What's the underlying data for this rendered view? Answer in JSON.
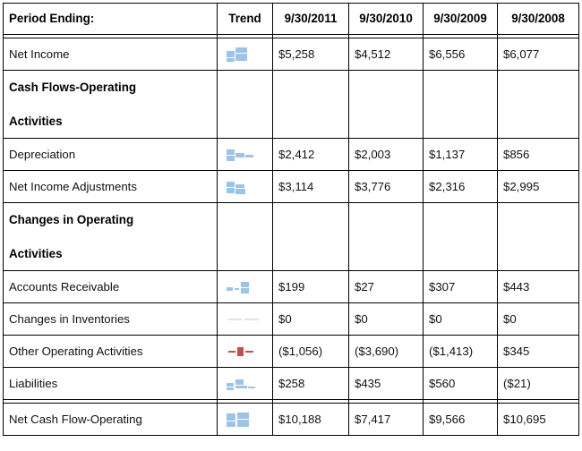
{
  "table": {
    "columns": [
      {
        "key": "label",
        "header": "Period Ending:",
        "align": "left"
      },
      {
        "key": "trend",
        "header": "Trend",
        "align": "center"
      },
      {
        "key": "y2011",
        "header": "9/30/2011",
        "align": "center"
      },
      {
        "key": "y2010",
        "header": "9/30/2010",
        "align": "center"
      },
      {
        "key": "y2009",
        "header": "9/30/2009",
        "align": "center"
      },
      {
        "key": "y2008",
        "header": "9/30/2008",
        "align": "center"
      }
    ],
    "rows": [
      {
        "type": "data",
        "label": "Net Income",
        "trend_icon": "sparkline-bars-blue",
        "trend_color": "#9dc3e6",
        "values": [
          "$5,258",
          "$4,512",
          "$6,556",
          "$6,077"
        ],
        "separator_before": true
      },
      {
        "type": "group",
        "label_line1": "Cash Flows-Operating",
        "label_line2": "Activities",
        "values": [
          "",
          "",
          "",
          ""
        ]
      },
      {
        "type": "data",
        "label": "Depreciation",
        "trend_icon": "sparkline-bars-blue",
        "trend_color": "#9dc3e6",
        "values": [
          "$2,412",
          "$2,003",
          "$1,137",
          "$856"
        ]
      },
      {
        "type": "data",
        "label": "Net Income Adjustments",
        "trend_icon": "sparkline-bars-blue",
        "trend_color": "#9dc3e6",
        "values": [
          "$3,114",
          "$3,776",
          "$2,316",
          "$2,995"
        ]
      },
      {
        "type": "group",
        "label_line1": "Changes in Operating",
        "label_line2": "Activities",
        "values": [
          "",
          "",
          "",
          ""
        ]
      },
      {
        "type": "data",
        "label": "Accounts Receivable",
        "trend_icon": "sparkline-bars-blue",
        "trend_color": "#9dc3e6",
        "values": [
          "$199",
          "$27",
          "$307",
          "$443"
        ]
      },
      {
        "type": "data",
        "label": "Changes in Inventories",
        "trend_icon": "sparkline-flat-line",
        "trend_color": "#d9d9d9",
        "values": [
          "$0",
          "$0",
          "$0",
          "$0"
        ]
      },
      {
        "type": "data",
        "label": "Other Operating Activities",
        "trend_icon": "sparkline-bars-red",
        "trend_color": "#c0504d",
        "values": [
          "($1,056)",
          "($3,690)",
          "($1,413)",
          "$345"
        ]
      },
      {
        "type": "data",
        "label": "Liabilities",
        "trend_icon": "sparkline-bars-blue",
        "trend_color": "#9dc3e6",
        "values": [
          "$258",
          "$435",
          "$560",
          "($21)"
        ]
      },
      {
        "type": "data",
        "label": "Net Cash Flow-Operating",
        "trend_icon": "sparkline-bars-blue",
        "trend_color": "#9dc3e6",
        "values": [
          "$10,188",
          "$7,417",
          "$9,566",
          "$10,695"
        ],
        "separator_before": true
      }
    ]
  },
  "chart_data": {
    "type": "table",
    "title": "Period Ending:",
    "categories": [
      "9/30/2011",
      "9/30/2010",
      "9/30/2009",
      "9/30/2008"
    ],
    "series": [
      {
        "name": "Net Income",
        "values": [
          5258,
          4512,
          6556,
          6077
        ]
      },
      {
        "name": "Depreciation",
        "values": [
          2412,
          2003,
          1137,
          856
        ]
      },
      {
        "name": "Net Income Adjustments",
        "values": [
          3114,
          3776,
          2316,
          2995
        ]
      },
      {
        "name": "Accounts Receivable",
        "values": [
          199,
          27,
          307,
          443
        ]
      },
      {
        "name": "Changes in Inventories",
        "values": [
          0,
          0,
          0,
          0
        ]
      },
      {
        "name": "Other Operating Activities",
        "values": [
          -1056,
          -3690,
          -1413,
          345
        ]
      },
      {
        "name": "Liabilities",
        "values": [
          258,
          435,
          560,
          -21
        ]
      },
      {
        "name": "Net Cash Flow-Operating",
        "values": [
          10188,
          7417,
          9566,
          10695
        ]
      }
    ],
    "groups": [
      "Cash Flows-Operating Activities",
      "Changes in Operating Activities"
    ],
    "xlabel": "",
    "ylabel": "",
    "grid": true,
    "legend": "none"
  },
  "colors": {
    "trend_blue": "#9dc3e6",
    "trend_red": "#c0504d",
    "trend_flat": "#d9d9d9",
    "border": "#000000",
    "text": "#111111"
  }
}
